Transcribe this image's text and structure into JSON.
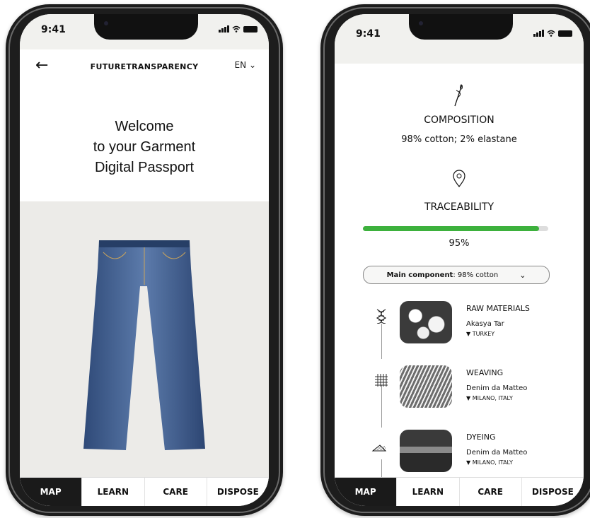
{
  "status": {
    "time": "9:41"
  },
  "left": {
    "brand": "FUTURETRANSPARENCY",
    "language": "EN",
    "welcome": [
      "Welcome",
      "to your Garment",
      "Digital Passport"
    ]
  },
  "right": {
    "composition": {
      "title": "COMPOSITION",
      "value": "98% cotton; 2% elastane"
    },
    "traceability": {
      "title": "TRACEABILITY",
      "percent_label": "95%",
      "percent": 0.95
    },
    "main_component": {
      "label": "Main component",
      "value": ": 98% cotton"
    },
    "stages": [
      {
        "title": "RAW MATERIALS",
        "supplier": "Akasya Tar",
        "location": "TURKEY"
      },
      {
        "title": "WEAVING",
        "supplier": "Denim da Matteo",
        "location": "MILANO, ITALY"
      },
      {
        "title": "DYEING",
        "supplier": "Denim da Matteo",
        "location": "MILANO, ITALY"
      }
    ]
  },
  "tabs": [
    "MAP",
    "LEARN",
    "CARE",
    "DISPOSE"
  ],
  "colors": {
    "progress": "#3db13d",
    "active_tab": "#1a1a1a",
    "hero_bg": "#ecebe8"
  }
}
